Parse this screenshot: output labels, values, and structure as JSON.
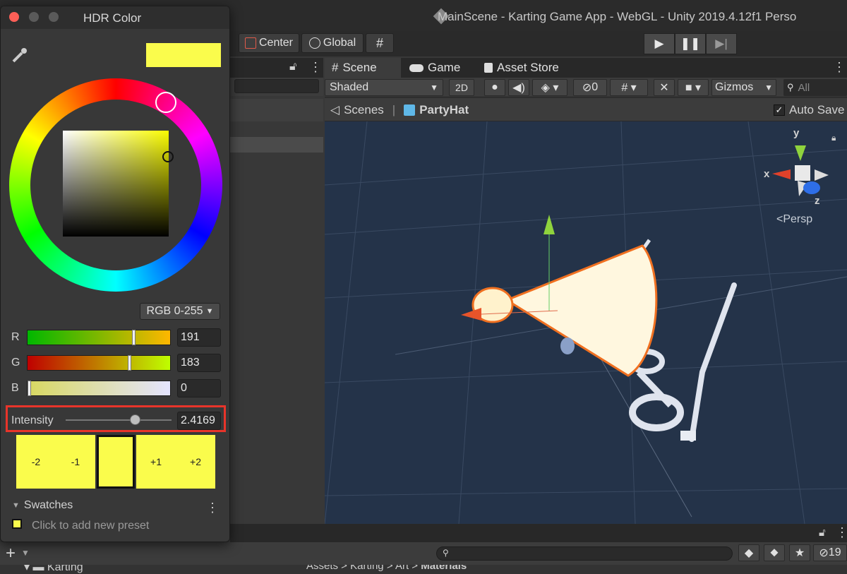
{
  "main_window": {
    "title": "MainScene - Karting Game App - WebGL - Unity 2019.4.12f1 Perso"
  },
  "toolbar": {
    "pivot_label": "Center",
    "space_label": "Global"
  },
  "scene_panel": {
    "tabs": [
      "Scene",
      "Game",
      "Asset Store"
    ],
    "shading_mode": "Shaded",
    "mode_2d_label": "2D",
    "hidden_count": "0",
    "gizmos_label": "Gizmos",
    "search_placeholder": "All",
    "breadcrumb_root": "Scenes",
    "breadcrumb_prefab": "PartyHat",
    "auto_save_label": "Auto Save",
    "auto_save_checked": true,
    "gizmo": {
      "x_label": "x",
      "y_label": "y",
      "z_label": "z",
      "projection_label": "Persp"
    }
  },
  "hdr_color_window": {
    "title": "HDR Color",
    "selected_color": "#fafc4c",
    "color_mode": "RGB 0-255",
    "channels": [
      {
        "label": "R",
        "value": "191",
        "fraction": 0.749
      },
      {
        "label": "G",
        "value": "183",
        "fraction": 0.718
      },
      {
        "label": "B",
        "value": "0",
        "fraction": 0.0
      }
    ],
    "intensity": {
      "label": "Intensity",
      "value": "2.4169",
      "fraction": 0.65
    },
    "exposure_swatches": [
      "-2",
      "-1",
      "",
      "+1",
      "+2"
    ],
    "swatches": {
      "header": "Swatches",
      "add_preset_hint": "Click to add new preset"
    }
  },
  "project_panel": {
    "folder_label": "Karting",
    "crumbs": [
      "Assets",
      "Karting",
      "Art",
      "Materials"
    ],
    "hidden_count": "19"
  },
  "colors": {
    "highlight_red": "#e8342a",
    "scene_background": "#243349",
    "cone_outline": "#f07020"
  }
}
